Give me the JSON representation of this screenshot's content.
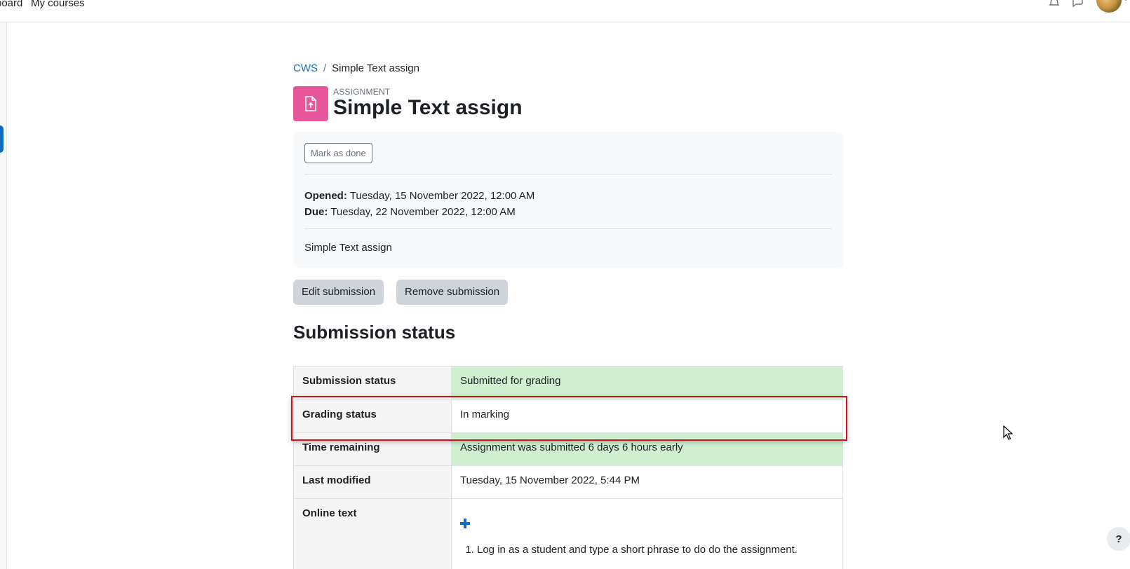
{
  "topnav": {
    "dashboard_label": "board",
    "mycourses_label": "My courses",
    "notifications_icon": "bell-icon",
    "messages_icon": "chat-icon"
  },
  "breadcrumb": {
    "course": "CWS",
    "separator": "/",
    "current": "Simple Text assign"
  },
  "activity": {
    "type_label": "ASSIGNMENT",
    "title": "Simple Text assign",
    "icon": "assignment-upload-icon",
    "icon_color": "#e9579b"
  },
  "info": {
    "mark_done_label": "Mark as done",
    "opened_label": "Opened:",
    "opened_value": "Tuesday, 15 November 2022, 12:00 AM",
    "due_label": "Due:",
    "due_value": "Tuesday, 22 November 2022, 12:00 AM",
    "intro": "Simple Text assign"
  },
  "actions": {
    "edit_label": "Edit submission",
    "remove_label": "Remove submission"
  },
  "submission": {
    "heading": "Submission status",
    "rows": [
      {
        "label": "Submission status",
        "value": "Submitted for grading"
      },
      {
        "label": "Grading status",
        "value": "In marking"
      },
      {
        "label": "Time remaining",
        "value": "Assignment was submitted 6 days 6 hours early"
      },
      {
        "label": "Last modified",
        "value": "Tuesday, 15 November 2022, 5:44 PM"
      },
      {
        "label": "Online text",
        "value": "1. Log in as a student and type a short phrase to do do the assignment."
      }
    ],
    "online_text_item": "Log in as a student and type a short phrase to do do the assignment."
  },
  "help": {
    "label": "?"
  },
  "colors": {
    "accent": "#0f6cbf",
    "success_bg": "#cfefcf",
    "highlight": "#d0101b"
  }
}
